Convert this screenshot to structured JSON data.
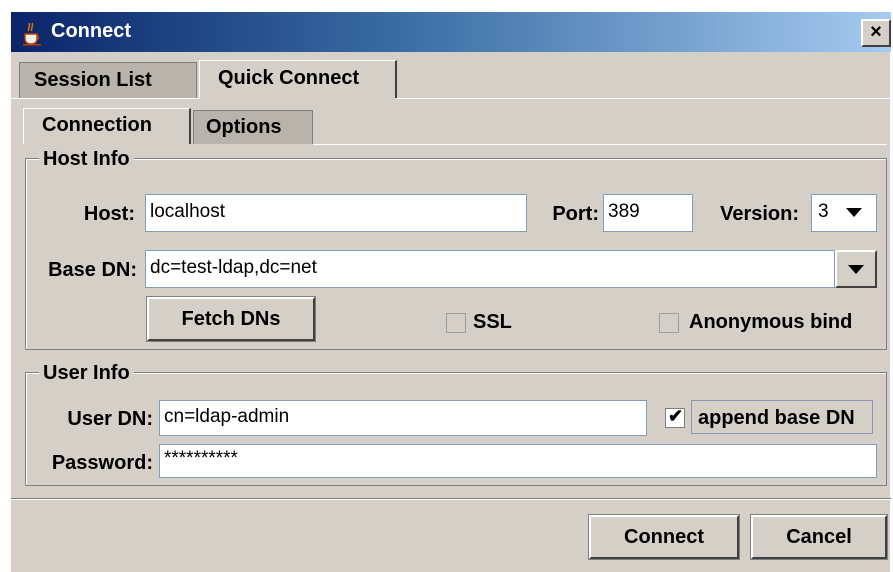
{
  "window": {
    "title": "Connect",
    "close_glyph": "×"
  },
  "tabs_outer": [
    "Session List",
    "Quick Connect"
  ],
  "tabs_inner": [
    "Connection",
    "Options"
  ],
  "host_info": {
    "legend": "Host Info",
    "host_label": "Host:",
    "host_value": "localhost",
    "port_label": "Port:",
    "port_value": "389",
    "version_label": "Version:",
    "version_value": "3",
    "basedn_label": "Base DN:",
    "basedn_value": "dc=test-ldap,dc=net",
    "fetch_button": "Fetch DNs",
    "ssl_label": "SSL",
    "ssl_checked": false,
    "anon_label": "Anonymous bind",
    "anon_checked": false
  },
  "user_info": {
    "legend": "User Info",
    "userdn_label": "User DN:",
    "userdn_value": "cn=ldap-admin",
    "append_label": "append base DN",
    "append_checked": true,
    "password_label": "Password:",
    "password_value": "**********"
  },
  "footer": {
    "connect_button": "Connect",
    "cancel_button": "Cancel"
  },
  "icons": {
    "title_icon": "java-cup-icon",
    "dropdown_icon": "chevron-down-icon"
  },
  "colors": {
    "titlebar_start": "#0a246a",
    "titlebar_end": "#a6caf0",
    "panel": "#d4d0c8",
    "field_border": "#7f9db9"
  }
}
